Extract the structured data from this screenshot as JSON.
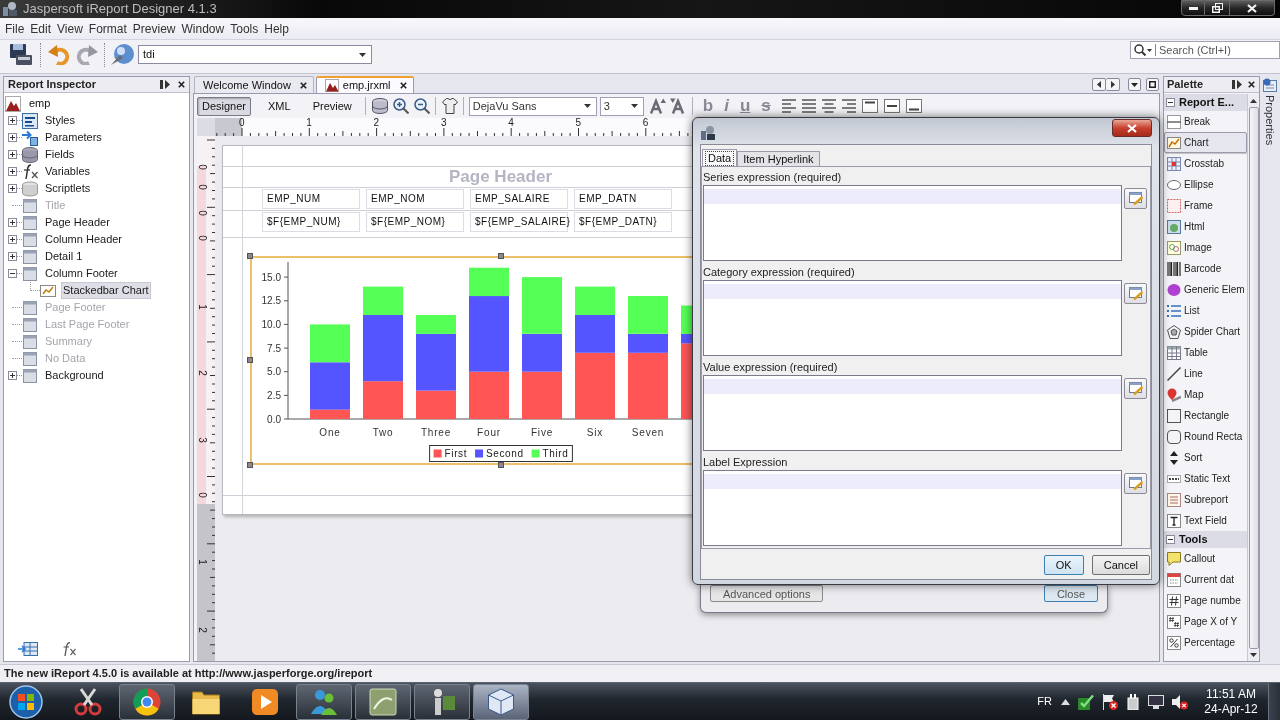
{
  "window": {
    "title": "Jaspersoft iReport Designer 4.1.3"
  },
  "menu": [
    "File",
    "Edit",
    "View",
    "Format",
    "Preview",
    "Window",
    "Tools",
    "Help"
  ],
  "toolbar": {
    "dropdown": "tdi",
    "search": {
      "placeholder": "Search (Ctrl+I)"
    }
  },
  "report_inspector": {
    "title": "Report Inspector",
    "root": {
      "label": "emp",
      "selected": false
    },
    "items": [
      {
        "label": "Styles",
        "kind": "styles",
        "expanded": false,
        "disabled": false,
        "selected": false
      },
      {
        "label": "Parameters",
        "kind": "parameters",
        "expanded": false,
        "disabled": false,
        "selected": false
      },
      {
        "label": "Fields",
        "kind": "fields",
        "expanded": false,
        "disabled": false,
        "selected": false
      },
      {
        "label": "Variables",
        "kind": "variables",
        "expanded": false,
        "disabled": false,
        "selected": false
      },
      {
        "label": "Scriptlets",
        "kind": "scriptlets",
        "expanded": false,
        "disabled": false,
        "selected": false
      },
      {
        "label": "Title",
        "kind": "band",
        "disabled": true,
        "selected": false
      },
      {
        "label": "Page Header",
        "kind": "band",
        "expanded": false,
        "disabled": false,
        "selected": false
      },
      {
        "label": "Column Header",
        "kind": "band",
        "expanded": false,
        "disabled": false,
        "selected": false
      },
      {
        "label": "Detail 1",
        "kind": "band",
        "expanded": false,
        "disabled": false,
        "selected": false
      },
      {
        "label": "Column Footer",
        "kind": "band",
        "expanded": true,
        "disabled": false,
        "selected": false,
        "children": [
          {
            "label": "Stackedbar Chart",
            "kind": "chart",
            "disabled": false,
            "selected": true
          }
        ]
      },
      {
        "label": "Page Footer",
        "kind": "band",
        "disabled": true,
        "selected": false
      },
      {
        "label": "Last Page Footer",
        "kind": "band",
        "disabled": true,
        "selected": false
      },
      {
        "label": "Summary",
        "kind": "band",
        "disabled": true,
        "selected": false
      },
      {
        "label": "No Data",
        "kind": "band",
        "disabled": true,
        "selected": false
      },
      {
        "label": "Background",
        "kind": "band",
        "expanded": false,
        "disabled": false,
        "selected": false
      }
    ]
  },
  "designer": {
    "tabs": [
      {
        "label": "Welcome Window",
        "kind": "welcome",
        "selected": false
      },
      {
        "label": "emp.jrxml",
        "kind": "report",
        "selected": true
      }
    ],
    "views": [
      {
        "label": "Designer",
        "selected": true
      },
      {
        "label": "XML",
        "selected": false
      },
      {
        "label": "Preview",
        "selected": false
      }
    ],
    "font": "DejaVu Sans",
    "font_size": "3",
    "format_buttons": [
      {
        "label": "b",
        "kind": "bold"
      },
      {
        "label": "i",
        "kind": "italic"
      },
      {
        "label": "u",
        "kind": "underline"
      },
      {
        "label": "s",
        "kind": "strikethrough"
      }
    ],
    "ruler": {
      "horizontal": [
        "0",
        "1",
        "2",
        "3",
        "4",
        "5",
        "6"
      ],
      "vertical": [
        "0",
        "0",
        "0",
        "0",
        "1",
        "2",
        "3",
        "0",
        "1",
        "2"
      ]
    },
    "page": {
      "band_labels": [
        "Page Header"
      ],
      "columns": [
        {
          "header": "EMP_NUM",
          "field": "$F{EMP_NUM}"
        },
        {
          "header": "EMP_NOM",
          "field": "$F{EMP_NOM}"
        },
        {
          "header": "EMP_SALAIRE",
          "field": "$F{EMP_SALAIRE}"
        },
        {
          "header": "EMP_DATN",
          "field": "$F{EMP_DATN}"
        }
      ],
      "chart_data": {
        "type": "bar",
        "stacked": true,
        "categories": [
          "One",
          "Two",
          "Three",
          "Four",
          "Five",
          "Six",
          "Seven",
          null
        ],
        "series": [
          {
            "name": "First",
            "color": "#ff5555",
            "values": [
              1,
              4,
              3,
              5,
              5,
              7,
              7,
              8
            ]
          },
          {
            "name": "Second",
            "color": "#5555ff",
            "values": [
              5,
              7,
              6,
              8,
              4,
              4,
              2,
              1
            ]
          },
          {
            "name": "Third",
            "color": "#55ff55",
            "values": [
              4,
              3,
              2,
              3,
              6,
              3,
              4,
              3
            ]
          }
        ],
        "yticks": [
          {
            "value": 0,
            "label": "0.0"
          },
          {
            "value": 2.5,
            "label": "2.5"
          },
          {
            "value": 5,
            "label": "5.0"
          },
          {
            "value": 7.5,
            "label": "7.5"
          },
          {
            "value": 10,
            "label": "10.0"
          },
          {
            "value": 12.5,
            "label": "12.5"
          },
          {
            "value": 15,
            "label": "15.0"
          }
        ],
        "ylim": [
          0,
          16.6
        ],
        "legend": "bottom"
      }
    }
  },
  "background_dialog": {
    "buttons": [
      {
        "label": "Advanced options",
        "default": false
      },
      {
        "label": "Close",
        "default": true
      }
    ]
  },
  "dialog": {
    "tabs": [
      {
        "label": "Data",
        "selected": true
      },
      {
        "label": "Item Hyperlink",
        "selected": false
      }
    ],
    "fields": [
      {
        "label": "Series expression (required)"
      },
      {
        "label": "Category expression (required)"
      },
      {
        "label": "Value expression (required)"
      },
      {
        "label": "Label Expression"
      }
    ],
    "buttons": [
      {
        "label": "OK",
        "default": true
      },
      {
        "label": "Cancel",
        "default": false
      }
    ]
  },
  "palette": {
    "title": "Palette",
    "sections": [
      {
        "label": "Report E...",
        "expanded": true,
        "items": [
          {
            "label": "Break",
            "kind": "break",
            "selected": false
          },
          {
            "label": "Chart",
            "kind": "chart",
            "selected": true
          },
          {
            "label": "Crosstab",
            "kind": "crosstab",
            "selected": false
          },
          {
            "label": "Ellipse",
            "kind": "ellipse",
            "selected": false
          },
          {
            "label": "Frame",
            "kind": "frame",
            "selected": false
          },
          {
            "label": "Html",
            "kind": "html",
            "selected": false
          },
          {
            "label": "Image",
            "kind": "image",
            "selected": false
          },
          {
            "label": "Barcode",
            "kind": "barcode",
            "selected": false
          },
          {
            "label": "Generic Elem",
            "kind": "generic",
            "selected": false
          },
          {
            "label": "List",
            "kind": "list",
            "selected": false
          },
          {
            "label": "Spider Chart",
            "kind": "spider",
            "selected": false
          },
          {
            "label": "Table",
            "kind": "table",
            "selected": false
          },
          {
            "label": "Line",
            "kind": "line",
            "selected": false
          },
          {
            "label": "Map",
            "kind": "map",
            "selected": false
          },
          {
            "label": "Rectangle",
            "kind": "rectangle",
            "selected": false
          },
          {
            "label": "Round Recta",
            "kind": "roundrect",
            "selected": false
          },
          {
            "label": "Sort",
            "kind": "sort",
            "selected": false
          },
          {
            "label": "Static Text",
            "kind": "statictext",
            "selected": false
          },
          {
            "label": "Subreport",
            "kind": "subreport",
            "selected": false
          },
          {
            "label": "Text Field",
            "kind": "textfield",
            "selected": false
          }
        ]
      },
      {
        "label": "Tools",
        "expanded": true,
        "items": [
          {
            "label": "Callout",
            "kind": "callout",
            "selected": false
          },
          {
            "label": "Current dat",
            "kind": "date",
            "selected": false
          },
          {
            "label": "Page numbe",
            "kind": "pagenumber",
            "selected": false
          },
          {
            "label": "Page X of Y",
            "kind": "pagexofy",
            "selected": false
          },
          {
            "label": "Percentage",
            "kind": "percentage",
            "selected": false
          }
        ]
      }
    ]
  },
  "properties_tab": {
    "label": "Properties"
  },
  "status_bar": {
    "text": "The new iReport 4.5.0 is available at http://www.jasperforge.org/ireport"
  },
  "taskbar": {
    "apps": [
      {
        "kind": "scissors",
        "running": false,
        "selected": false
      },
      {
        "kind": "browser",
        "running": true,
        "selected": false
      },
      {
        "kind": "folder",
        "running": false,
        "selected": false
      },
      {
        "kind": "media",
        "running": false,
        "selected": false
      },
      {
        "kind": "people",
        "running": true,
        "selected": false
      },
      {
        "kind": "sheet",
        "running": true,
        "selected": false
      },
      {
        "kind": "figure",
        "running": true,
        "selected": false
      },
      {
        "kind": "cube",
        "running": true,
        "selected": true
      }
    ],
    "language": "FR",
    "time": "11:51 AM",
    "date": "24-Apr-12"
  }
}
